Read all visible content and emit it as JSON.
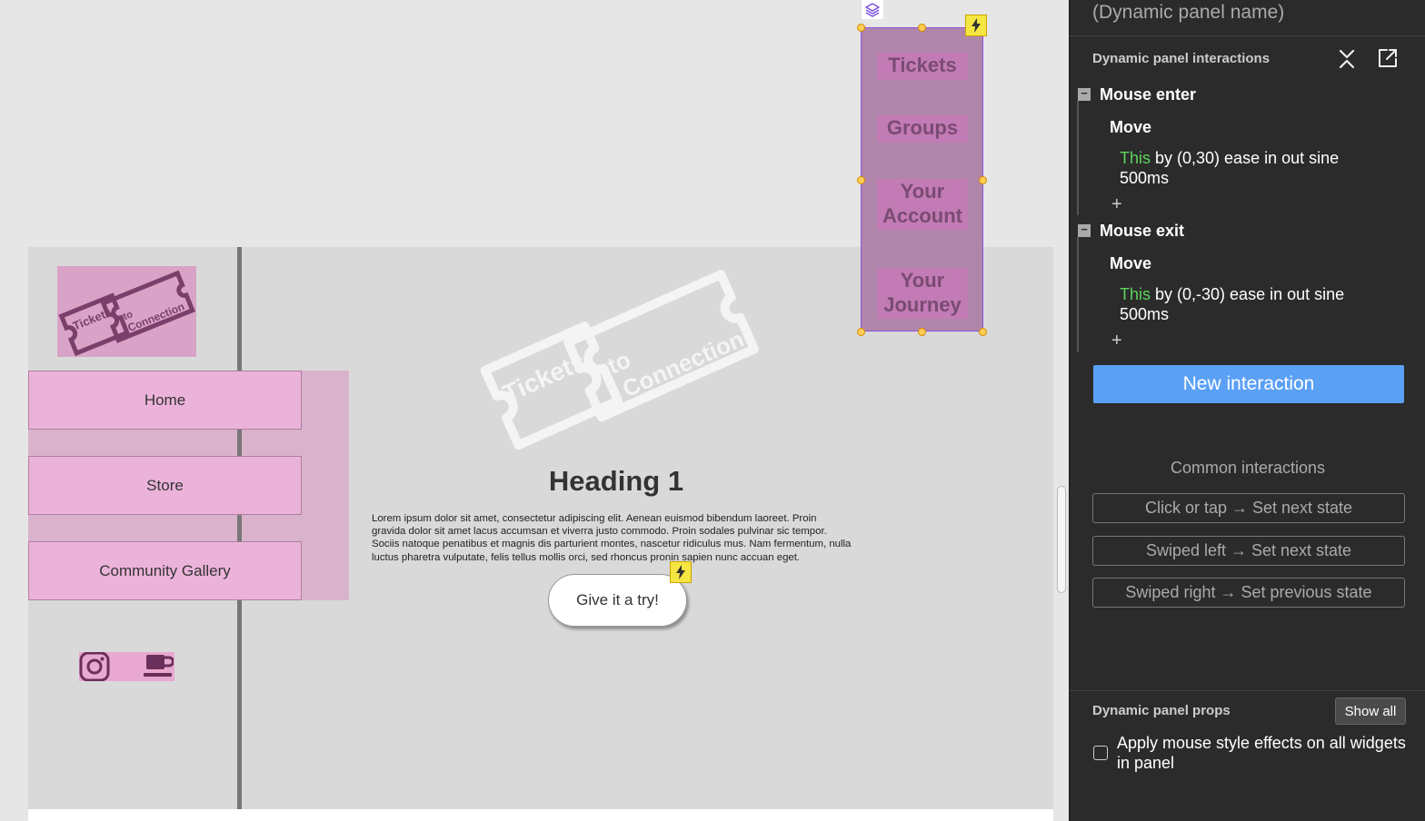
{
  "canvas": {
    "nav": {
      "home": "Home",
      "store": "Store",
      "gallery": "Community Gallery"
    },
    "logo_text": {
      "line1": "Tickets",
      "line2": "to",
      "line3": "Connection"
    },
    "heading": "Heading 1",
    "lorem": "Lorem ipsum dolor sit amet, consectetur adipiscing elit. Aenean euismod bibendum laoreet. Proin gravida dolor sit amet lacus accumsan et viverra justo commodo. Proin sodales pulvinar sic tempor. Sociis natoque penatibus et magnis dis parturient montes, nascetur ridiculus mus. Nam fermentum, nulla luctus pharetra vulputate, felis tellus mollis orci, sed rhoncus pronin sapien nunc accuan eget.",
    "try_button": "Give it a try!",
    "dynamic_panel": {
      "items": [
        "Tickets",
        "Groups",
        "Your Account",
        "Your Journey"
      ]
    },
    "icons": [
      "layers-icon",
      "lightning-bolt-icon",
      "instagram-icon",
      "coffee-cup-icon"
    ]
  },
  "panel": {
    "name_placeholder": "(Dynamic panel name)",
    "interactions_title": "Dynamic panel interactions",
    "events": [
      {
        "title": "Mouse enter",
        "action": "Move",
        "target": "This",
        "desc": " by (0,30) ease in out sine 500ms"
      },
      {
        "title": "Mouse exit",
        "action": "Move",
        "target": "This",
        "desc": " by (0,-30) ease in out sine 500ms"
      }
    ],
    "add_symbol": "+",
    "collapse_symbol": "−",
    "new_interaction": "New interaction",
    "common_title": "Common interactions",
    "common": [
      "Click or tap → Set next state",
      "Swiped left → Set next state",
      "Swiped right → Set previous state"
    ],
    "props_title": "Dynamic panel props",
    "show_all": "Show all",
    "checkbox_label": "Apply mouse style effects on all widgets in panel"
  },
  "colors": {
    "accent": "#5aa0f5",
    "target_green": "#5ed35e",
    "selection": "#8a52e0",
    "panel_bg": "#2b2b2b",
    "nav_pink": "#ecb3da"
  }
}
